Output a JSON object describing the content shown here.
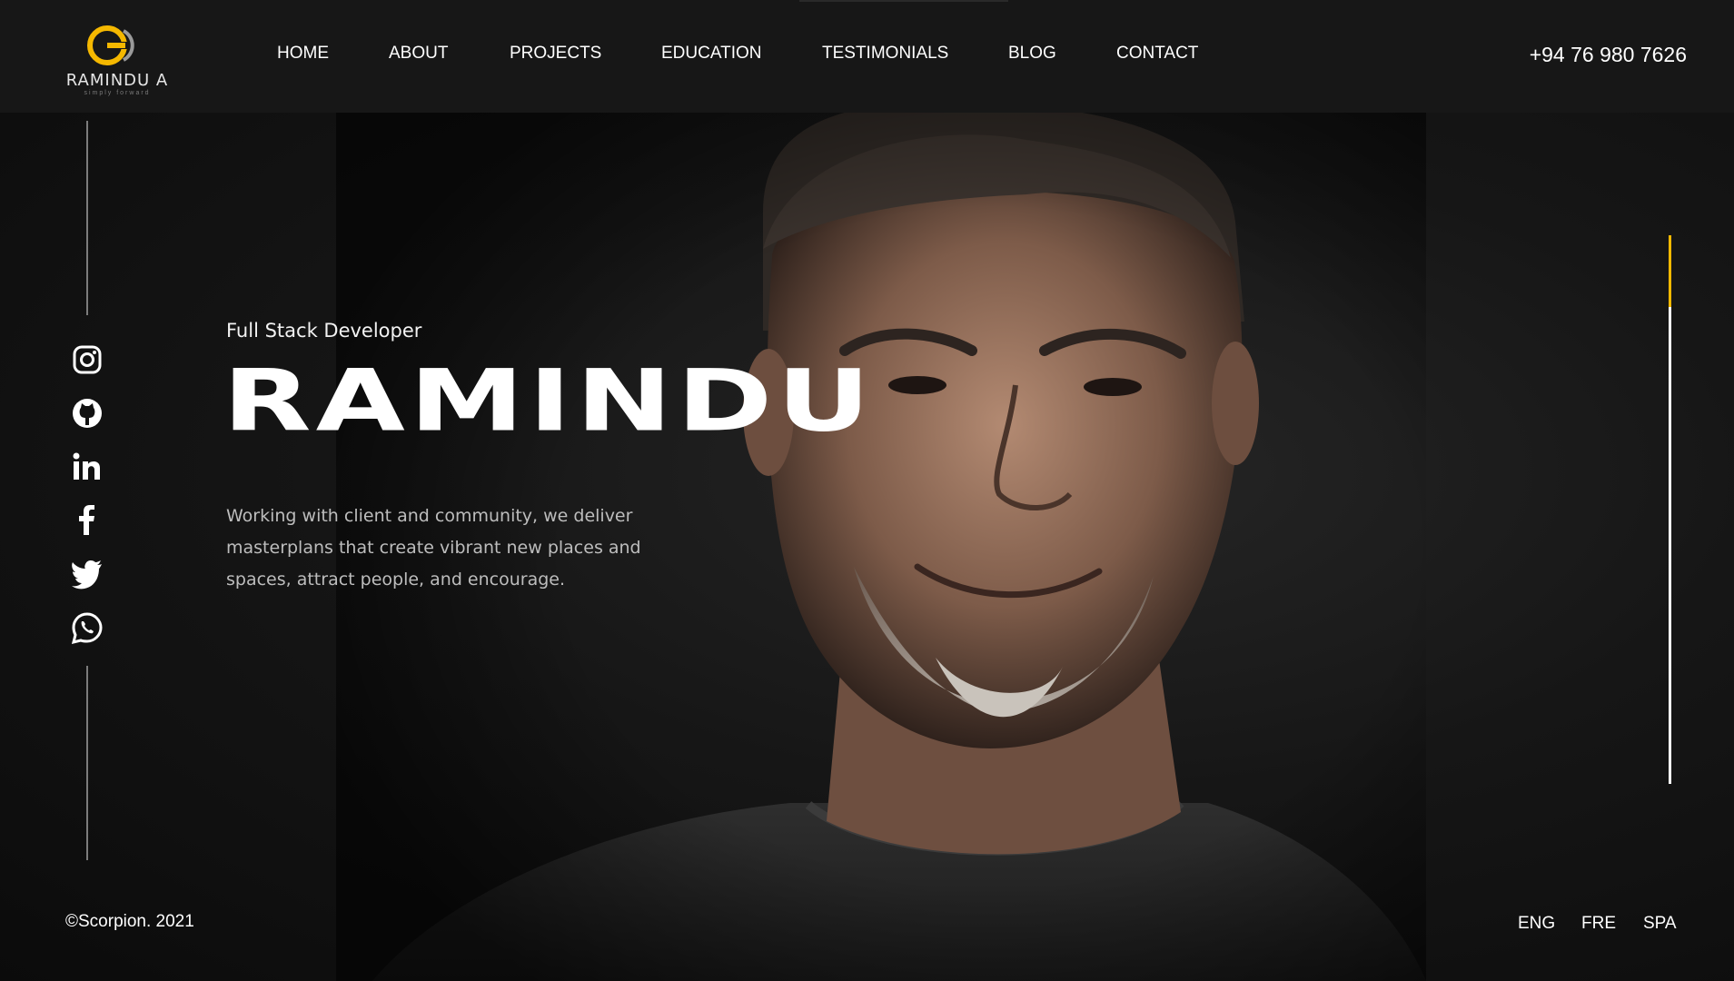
{
  "brand": {
    "name": "RAMINDU A",
    "tagline": "simply forward",
    "accent_color": "#f5b800"
  },
  "nav": {
    "items": [
      "HOME",
      "ABOUT",
      "PROJECTS",
      "EDUCATION",
      "TESTIMONIALS",
      "BLOG",
      "CONTACT"
    ]
  },
  "header": {
    "phone": "+94 76 980 7626"
  },
  "hero": {
    "subtitle": "Full Stack Developer",
    "name": "RAMINDU",
    "description": "Working with client and community, we deliver masterplans that create vibrant new places and spaces, attract people, and encourage."
  },
  "social": {
    "icons": [
      "instagram-icon",
      "github-icon",
      "linkedin-icon",
      "facebook-icon",
      "twitter-icon",
      "whatsapp-icon"
    ]
  },
  "scroll_progress": {
    "fraction": 0.13
  },
  "footer": {
    "copyright": "©Scorpion. 2021",
    "languages": [
      "ENG",
      "FRE",
      "SPA"
    ]
  }
}
